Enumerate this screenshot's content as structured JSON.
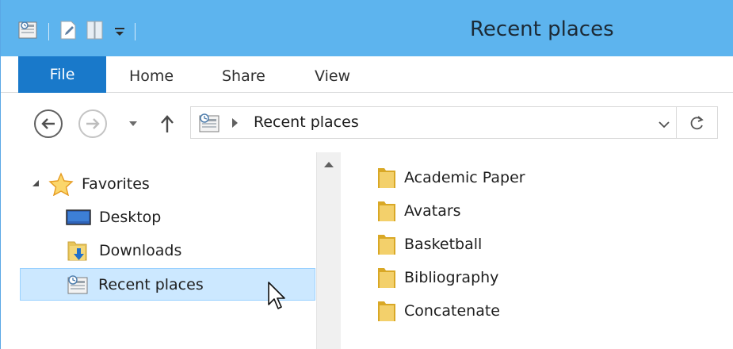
{
  "window": {
    "title": "Recent places"
  },
  "quick_access_toolbar": {
    "icons": [
      "recent-places-icon",
      "properties-icon",
      "new-folder-icon",
      "customize-toolbar-icon"
    ]
  },
  "ribbon": {
    "tabs": [
      {
        "label": "File",
        "active": true
      },
      {
        "label": "Home"
      },
      {
        "label": "Share"
      },
      {
        "label": "View"
      }
    ]
  },
  "navigation": {
    "back_icon": "back-arrow-icon",
    "forward_icon": "forward-arrow-icon",
    "recent_icon": "chevron-down-icon",
    "up_icon": "up-arrow-icon"
  },
  "address_bar": {
    "location": "Recent places",
    "icon": "recent-places-icon"
  },
  "nav_pane": {
    "favorites": {
      "label": "Favorites",
      "expanded": true,
      "items": [
        {
          "label": "Desktop",
          "icon": "desktop-icon"
        },
        {
          "label": "Downloads",
          "icon": "downloads-folder-icon"
        },
        {
          "label": "Recent places",
          "icon": "recent-places-icon",
          "selected": true
        }
      ]
    }
  },
  "content": {
    "items": [
      {
        "name": "Academic Paper",
        "icon": "folder-icon"
      },
      {
        "name": "Avatars",
        "icon": "folder-icon"
      },
      {
        "name": "Basketball",
        "icon": "folder-icon"
      },
      {
        "name": "Bibliography",
        "icon": "folder-icon"
      },
      {
        "name": "Concatenate",
        "icon": "folder-icon"
      }
    ]
  },
  "colors": {
    "titlebar": "#5db4ee",
    "file_tab": "#1979ca",
    "selection": "#cce8ff",
    "folder": "#e8c55a"
  }
}
